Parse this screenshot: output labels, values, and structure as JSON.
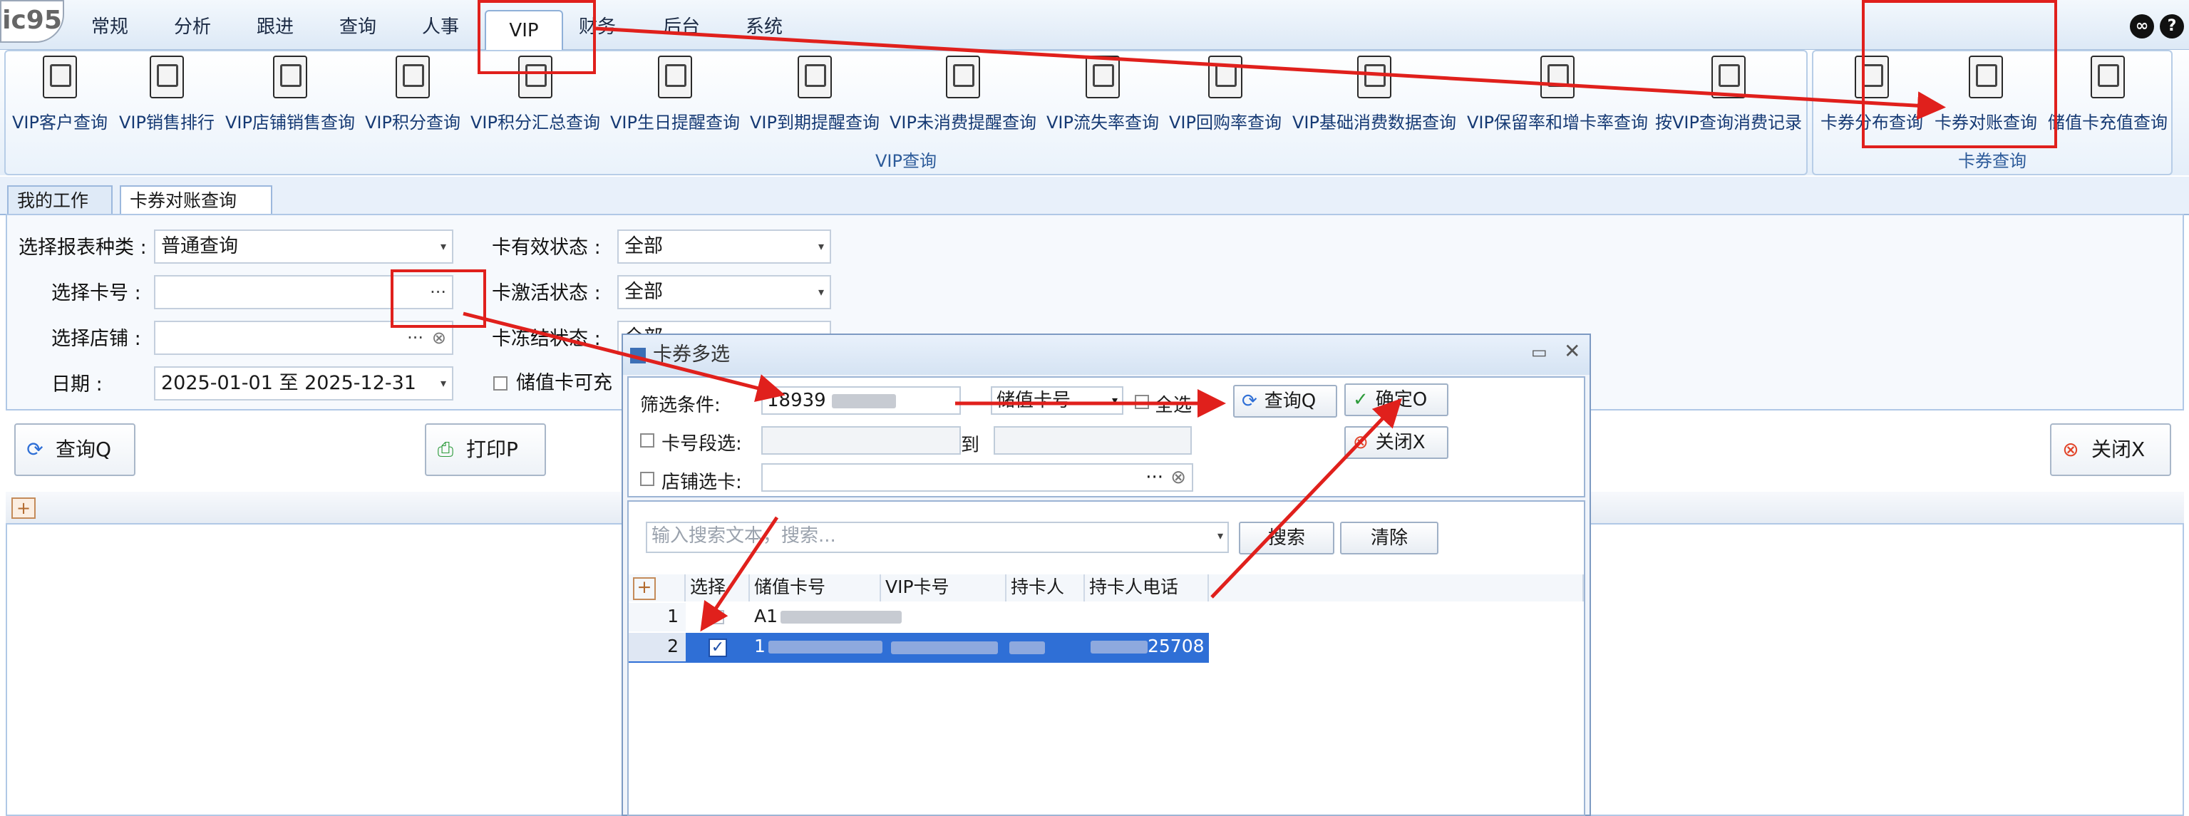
{
  "logo": "ic95",
  "menu": [
    "常规",
    "分析",
    "跟进",
    "查询",
    "人事",
    "VIP",
    "财务",
    "后台",
    "系统"
  ],
  "ribbon": {
    "vip_group_label": "VIP查询",
    "card_group_label": "卡券查询",
    "vip_buttons": [
      "VIP客户查询",
      "VIP销售排行",
      "VIP店铺销售查询",
      "VIP积分查询",
      "VIP积分汇总查询",
      "VIP生日提醒查询",
      "VIP到期提醒查询",
      "VIP未消费提醒查询",
      "VIP流失率查询",
      "VIP回购率查询",
      "VIP基础消费数据查询",
      "VIP保留率和增卡率查询",
      "按VIP查询消费记录"
    ],
    "card_buttons": [
      "卡券分布查询",
      "卡券对账查询",
      "储值卡充值查询"
    ]
  },
  "tabs": {
    "workspace": "我的工作台",
    "active": "卡券对账查询",
    "close": "✕"
  },
  "form": {
    "report_type_label": "选择报表种类 :",
    "report_type_value": "普通查询",
    "card_no_label": "选择卡号 :",
    "card_no_button": "···",
    "store_label": "选择店铺 :",
    "store_button": "···",
    "date_label": "日期 :",
    "date_value": "2025-01-01 至 2025-12-31",
    "valid_status_label": "卡有效状态 :",
    "valid_status_value": "全部",
    "active_status_label": "卡激活状态 :",
    "active_status_value": "全部",
    "frozen_status_label": "卡冻结状态 :",
    "frozen_status_value": "全部",
    "stored_value_check": "储值卡可充"
  },
  "buttons": {
    "query": "查询Q",
    "print": "打印P",
    "close": "关闭X"
  },
  "dialog": {
    "title": "卡券多选",
    "filter_label": "筛选条件:",
    "filter_value": "18939",
    "filter_type": "储值卡号",
    "select_all": "全选",
    "query_button": "查询Q",
    "confirm_button": "确定O",
    "close_button": "关闭X",
    "card_range_label": "卡号段选:",
    "range_to": "到",
    "store_card_label": "店铺选卡:",
    "store_card_button": "···",
    "search_placeholder": "输入搜索文本，搜索...",
    "search_button": "搜索",
    "clear_button": "清除",
    "columns": [
      "选择",
      "储值卡号",
      "VIP卡号",
      "持卡人",
      "持卡人电话"
    ],
    "rows": [
      {
        "index": "1",
        "checked": false,
        "card": "A1"
      },
      {
        "index": "2",
        "checked": true,
        "card": "1",
        "phone_tail": "25708"
      }
    ]
  },
  "colors": {
    "annotation": "#e0201c",
    "selected_row": "#2f6fd6"
  }
}
